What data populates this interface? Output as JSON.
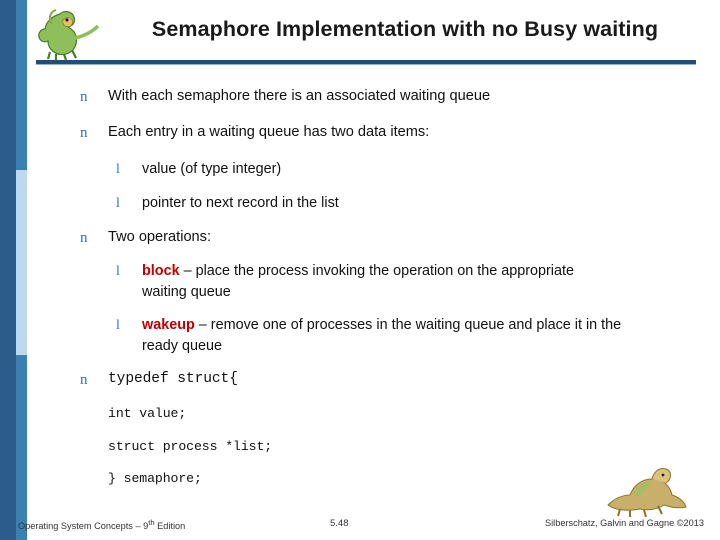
{
  "slide": {
    "title": "Semaphore Implementation with no Busy waiting",
    "bullets": [
      {
        "level": 1,
        "marker": "n",
        "text": "With each semaphore there is an associated waiting queue"
      },
      {
        "level": 1,
        "marker": "n",
        "text": "Each entry in a waiting queue has two data items:"
      },
      {
        "level": 2,
        "marker": "l",
        "text": "value (of type integer)"
      },
      {
        "level": 2,
        "marker": "l",
        "text": "pointer to next record in the list"
      },
      {
        "level": 1,
        "marker": "n",
        "text": "Two operations:"
      },
      {
        "level": 2,
        "marker": "l",
        "keyword": "block",
        "text": " – place the process invoking the operation on the appropriate waiting queue"
      },
      {
        "level": 2,
        "marker": "l",
        "keyword": "wakeup",
        "text": " – remove one of processes in the waiting queue and place it in the ready queue"
      }
    ],
    "code_bullet_marker": "n",
    "code_lines": [
      "typedef struct{",
      "int value;",
      "struct process *list;",
      "} semaphore;"
    ]
  },
  "footer": {
    "left": "Operating System Concepts – 9",
    "left_sup": "th",
    "left_tail": " Edition",
    "center": "5.48",
    "right": "Silberschatz, Galvin and Gagne ©2013"
  },
  "colors": {
    "title_text": "#1a1a1a",
    "rule": "#1f4e79",
    "bullet_marker": "#2e74b5",
    "keyword": "#c00000",
    "stripe_dark": "#2b5c8a",
    "stripe_light": "#bcd9f0"
  }
}
